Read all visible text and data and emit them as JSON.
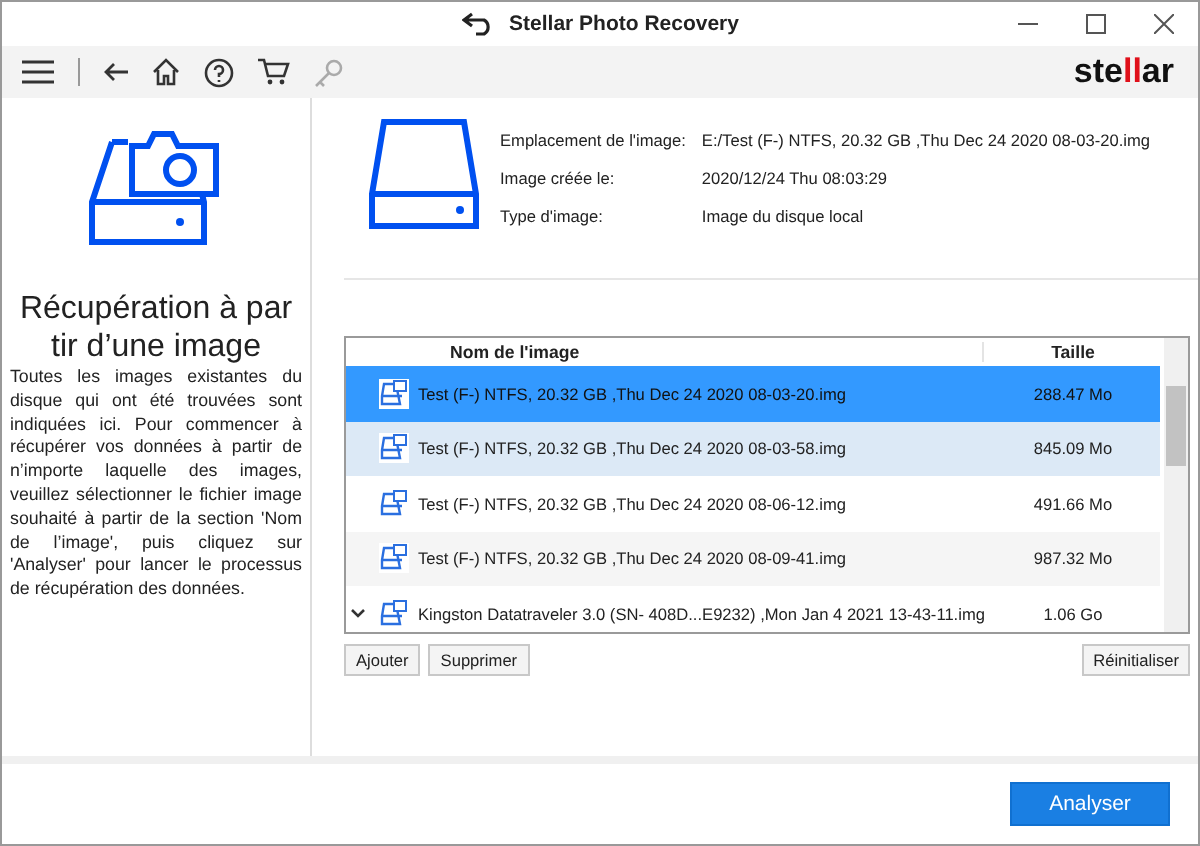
{
  "window": {
    "title": "Stellar Photo Recovery"
  },
  "brand": {
    "prefix": "ste",
    "mark": "ll",
    "suffix": "ar"
  },
  "sidebar": {
    "title": "Récupération à par tir d’une image",
    "description": "Toutes les images existantes du disque qui ont été trouvées sont indiquées ici. Pour commencer à récupérer vos données à partir de n’importe laquelle des images, veuillez sélectionner le fichier image souhaité à partir de la section 'Nom de l’image', puis cliquez sur 'Analyser' pour lancer le processus de récupération des données."
  },
  "details": [
    {
      "label": "Emplacement de l'image:",
      "value": "E:/Test (F-) NTFS, 20.32 GB ,Thu Dec 24 2020 08-03-20.img"
    },
    {
      "label": "Image créée le:",
      "value": "2020/12/24 Thu 08:03:29"
    },
    {
      "label": "Type d'image:",
      "value": "Image du disque local"
    }
  ],
  "table": {
    "columns": [
      "Nom de l'image",
      "Taille"
    ],
    "rows": [
      {
        "name": "Test (F-) NTFS, 20.32 GB ,Thu Dec 24 2020 08-03-20.img",
        "size": "288.47 Mo",
        "selected": true,
        "hovered": false,
        "expandable": false
      },
      {
        "name": "Test (F-) NTFS, 20.32 GB ,Thu Dec 24 2020 08-03-58.img",
        "size": "845.09 Mo",
        "selected": false,
        "hovered": true,
        "expandable": false
      },
      {
        "name": "Test (F-) NTFS, 20.32 GB ,Thu Dec 24 2020 08-06-12.img",
        "size": "491.66 Mo",
        "selected": false,
        "hovered": false,
        "expandable": false
      },
      {
        "name": "Test (F-) NTFS, 20.32 GB ,Thu Dec 24 2020 08-09-41.img",
        "size": "987.32 Mo",
        "selected": false,
        "hovered": false,
        "expandable": false
      },
      {
        "name": "Kingston Datatraveler 3.0 (SN- 408D...E9232) ,Mon Jan 4 2021 13-43-11.img",
        "size": "1.06 Go",
        "selected": false,
        "hovered": false,
        "expandable": true
      }
    ]
  },
  "list_buttons": [
    "Ajouter",
    "Supprimer"
  ],
  "reset_button": "Réinitialiser",
  "primary_button": "Analyser"
}
